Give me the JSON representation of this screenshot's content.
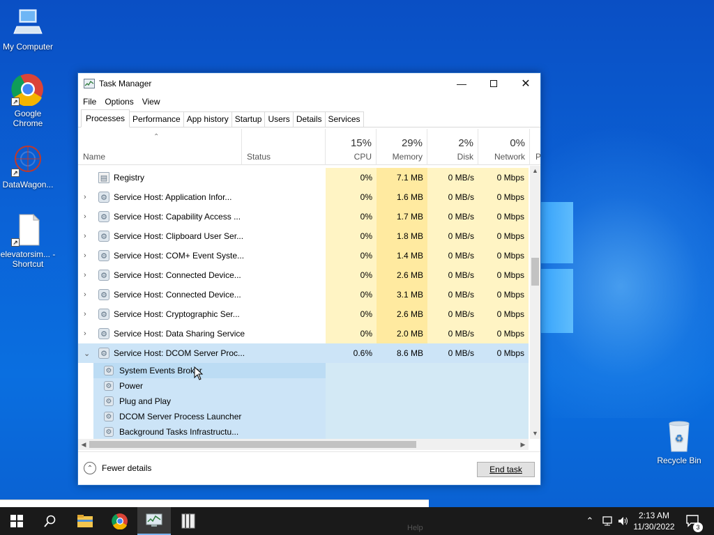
{
  "desktop": {
    "icons": [
      {
        "label": "My Computer",
        "icon": "computer-icon"
      },
      {
        "label": "Google Chrome",
        "icon": "chrome-icon"
      },
      {
        "label": "DataWagon...",
        "icon": "datawagon-icon"
      },
      {
        "label": "elevatorsim... - Shortcut",
        "icon": "file-icon"
      },
      {
        "label": "Recycle Bin",
        "icon": "recycle-bin-icon"
      }
    ]
  },
  "window": {
    "title": "Task Manager",
    "menu": [
      "File",
      "Options",
      "View"
    ],
    "tabs": [
      "Processes",
      "Performance",
      "App history",
      "Startup",
      "Users",
      "Details",
      "Services"
    ],
    "active_tab": "Processes",
    "columns": {
      "name": "Name",
      "status": "Status",
      "cpu": {
        "pct": "15%",
        "label": "CPU"
      },
      "memory": {
        "pct": "29%",
        "label": "Memory"
      },
      "disk": {
        "pct": "2%",
        "label": "Disk"
      },
      "network": {
        "pct": "0%",
        "label": "Network"
      },
      "power": "P"
    },
    "processes": [
      {
        "name": "Registry",
        "cpu": "0%",
        "memory": "7.1 MB",
        "disk": "0 MB/s",
        "network": "0 Mbps",
        "expander": ""
      },
      {
        "name": "Service Host: Application Infor...",
        "cpu": "0%",
        "memory": "1.6 MB",
        "disk": "0 MB/s",
        "network": "0 Mbps",
        "expander": "›"
      },
      {
        "name": "Service Host: Capability Access ...",
        "cpu": "0%",
        "memory": "1.7 MB",
        "disk": "0 MB/s",
        "network": "0 Mbps",
        "expander": "›"
      },
      {
        "name": "Service Host: Clipboard User Ser...",
        "cpu": "0%",
        "memory": "1.8 MB",
        "disk": "0 MB/s",
        "network": "0 Mbps",
        "expander": "›"
      },
      {
        "name": "Service Host: COM+ Event Syste...",
        "cpu": "0%",
        "memory": "1.4 MB",
        "disk": "0 MB/s",
        "network": "0 Mbps",
        "expander": "›"
      },
      {
        "name": "Service Host: Connected Device...",
        "cpu": "0%",
        "memory": "2.6 MB",
        "disk": "0 MB/s",
        "network": "0 Mbps",
        "expander": "›"
      },
      {
        "name": "Service Host: Connected Device...",
        "cpu": "0%",
        "memory": "3.1 MB",
        "disk": "0 MB/s",
        "network": "0 Mbps",
        "expander": "›"
      },
      {
        "name": "Service Host: Cryptographic Ser...",
        "cpu": "0%",
        "memory": "2.6 MB",
        "disk": "0 MB/s",
        "network": "0 Mbps",
        "expander": "›"
      },
      {
        "name": "Service Host: Data Sharing Service",
        "cpu": "0%",
        "memory": "2.0 MB",
        "disk": "0 MB/s",
        "network": "0 Mbps",
        "expander": "›"
      },
      {
        "name": "Service Host: DCOM Server Proc...",
        "cpu": "0.6%",
        "memory": "8.6 MB",
        "disk": "0 MB/s",
        "network": "0 Mbps",
        "expander": "⌄"
      }
    ],
    "sub_services": [
      "System Events Broker",
      "Power",
      "Plug and Play",
      "DCOM Server Process Launcher",
      "Background Tasks Infrastructu..."
    ],
    "footer": {
      "fewer_details": "Fewer details",
      "end_task": "End task"
    }
  },
  "taskbar": {
    "time": "2:13 AM",
    "date": "11/30/2022",
    "notification_count": "3",
    "ghost_text": "Help"
  }
}
